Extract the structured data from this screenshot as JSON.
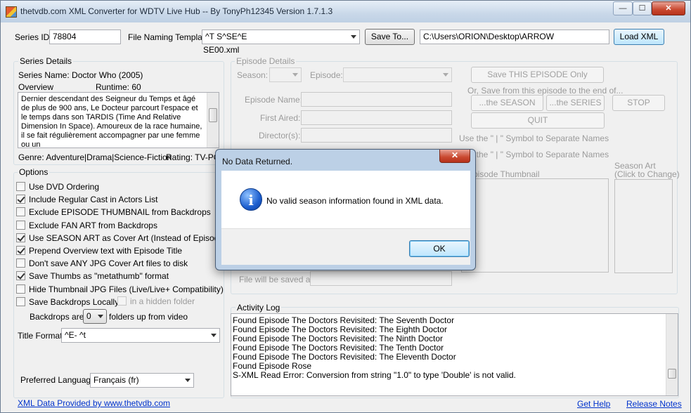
{
  "window": {
    "title": "thetvdb.com XML Converter for WDTV Live Hub -- By TonyPh12345 Version 1.7.1.3",
    "minimize_glyph": "—",
    "maximize_glyph": "☐",
    "close_glyph": "✕"
  },
  "top": {
    "series_id_label": "Series ID:",
    "series_id_value": "78804",
    "template_label": "File Naming Template:",
    "template_value": "^T S^SE^E",
    "template_preview": "SE00.xml",
    "save_to_label": "Save To...",
    "save_path": "C:\\Users\\ORION\\Desktop\\ARROW",
    "load_xml_label": "Load XML"
  },
  "series_details": {
    "group_title": "Series Details",
    "series_name": "Series Name: Doctor Who (2005)",
    "overview_label": "Overview",
    "runtime": "Runtime: 60",
    "overview_text": "Dernier descendant des Seigneur du Temps et âgé de plus de 900 ans, Le Docteur parcourt l'espace et le temps dans son TARDIS (Time And Relative Dimension In Space). Amoureux de la race humaine, il se fait régulièrement accompagner par une femme ou un",
    "genre": "Genre: Adventure|Drama|Science-Fiction",
    "rating": "Rating: TV-PG"
  },
  "options": {
    "group_title": "Options",
    "items": [
      {
        "label": "Use DVD Ordering",
        "checked": false
      },
      {
        "label": "Include Regular Cast in Actors List",
        "checked": true
      },
      {
        "label": "Exclude EPISODE THUMBNAIL from Backdrops",
        "checked": false
      },
      {
        "label": "Exclude FAN ART from Backdrops",
        "checked": false
      },
      {
        "label": "Use SEASON ART as Cover Art (Instead of Episode Art)",
        "checked": true
      },
      {
        "label": "Prepend Overview text with Episode Title",
        "checked": true
      },
      {
        "label": "Don't save ANY JPG Cover Art files to disk",
        "checked": false
      },
      {
        "label": "Save Thumbs as \"metathumb\" format",
        "checked": true
      },
      {
        "label": "Hide Thumbnail JPG Files (Live/Live+ Compatibility)",
        "checked": false
      },
      {
        "label": "Save Backdrops Locally",
        "checked": false
      }
    ],
    "hidden_folder_label": "in a hidden folder",
    "backdrops_label": "Backdrops are",
    "backdrops_value": "0",
    "backdrops_suffix": "folders up from video",
    "title_format_label": "Title Format :",
    "title_format_value": "^E- ^t",
    "language_label": "Preferred Language:",
    "language_value": "Français (fr)"
  },
  "episode_details": {
    "group_title": "Episode Details",
    "season_label": "Season:",
    "episode_label": "Episode:",
    "episode_name_label": "Episode Name:",
    "first_aired_label": "First Aired:",
    "directors_label": "Director(s):",
    "save_this_label": "Save THIS EPISODE Only",
    "or_save_label": "Or, Save from this episode to the end of...",
    "the_season_label": "...the SEASON",
    "the_series_label": "...the SERIES",
    "stop_label": "STOP",
    "quit_label": "QUIT",
    "separator_hint_1": "Use the \" | \" Symbol to Separate Names",
    "separator_hint_2": "Use the \" | \" Symbol to Separate Names",
    "episode_thumb_label": "Episode Thumbnail",
    "season_art_label": "Season Art",
    "season_art_hint": "(Click to Change)",
    "file_saved_label": "File will be saved as:"
  },
  "activity_log": {
    "group_title": "Activity Log",
    "lines": [
      "Found Episode The Doctors Revisited: The Seventh Doctor",
      "Found Episode The Doctors Revisited: The Eighth Doctor",
      "Found Episode The Doctors Revisited: The Ninth Doctor",
      "Found Episode The Doctors Revisited: The Tenth Doctor",
      "Found Episode The Doctors Revisited: The Eleventh Doctor",
      "Found Episode Rose",
      "S-XML Read Error: Conversion from string \"1.0\" to type 'Double' is not valid."
    ]
  },
  "footer": {
    "provided_by": "XML Data Provided by www.thetvdb.com",
    "get_help": "Get Help",
    "release_notes": "Release Notes"
  },
  "dialog": {
    "title": "No Data Returned.",
    "message": "No valid season information found in XML data.",
    "ok_label": "OK",
    "close_glyph": "✕",
    "icon_glyph": "i"
  },
  "colors": {
    "link": "#0033cc",
    "dialog_frame": "#bcd0e6",
    "close_button": "#c9482f"
  }
}
